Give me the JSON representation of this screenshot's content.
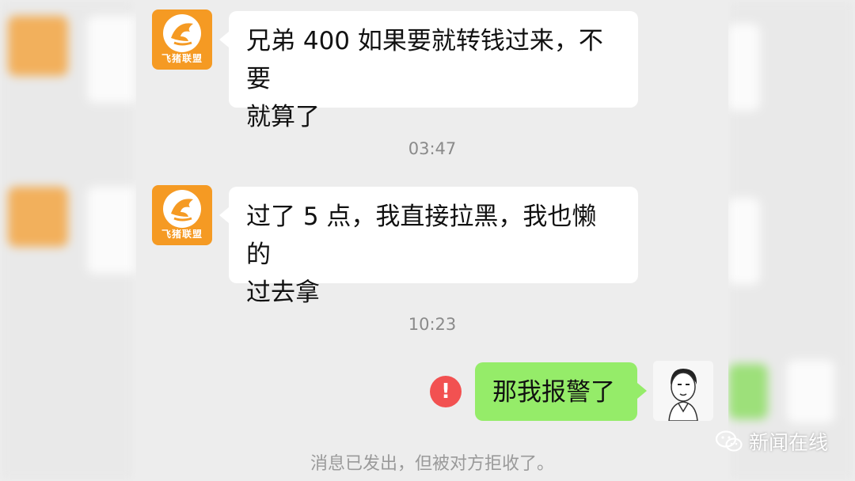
{
  "contact": {
    "avatar_brand": "飞猪联盟"
  },
  "messages": [
    {
      "side": "left",
      "text_line1": "兄弟 400 如果要就转钱过来，不要",
      "text_line2": "就算了"
    },
    {
      "side": "left",
      "text_line1": "过了 5 点，我直接拉黑，我也懒的",
      "text_line2": "过去拿"
    },
    {
      "side": "right",
      "text": "那我报警了",
      "status": "failed"
    }
  ],
  "timestamps": [
    "03:47",
    "10:23"
  ],
  "system_notice": "消息已发出，但被对方拒收了。",
  "error_badge": "!",
  "watermark": {
    "text": "新闻在线",
    "icon": "wechat-icon"
  },
  "colors": {
    "chat_bg": "#ededed",
    "bubble_received": "#ffffff",
    "bubble_sent": "#95ec69",
    "error": "#f25151",
    "avatar_orange": "#f59a23"
  }
}
